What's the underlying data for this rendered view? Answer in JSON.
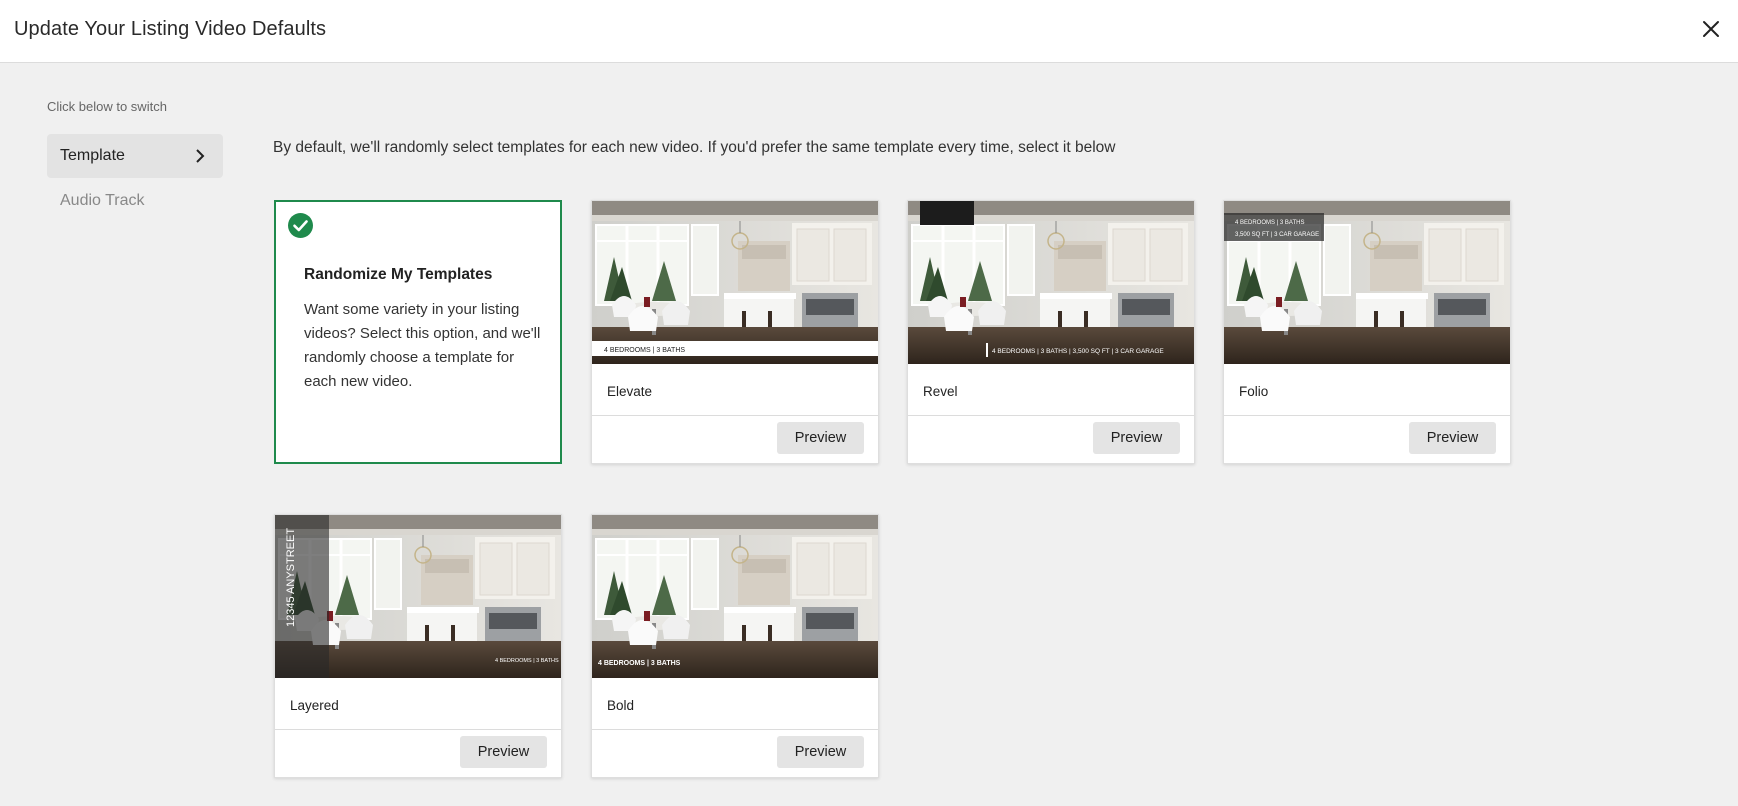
{
  "header": {
    "title": "Update Your Listing Video Defaults"
  },
  "sidebar": {
    "hint": "Click below to switch",
    "items": [
      {
        "label": "Template",
        "active": true
      },
      {
        "label": "Audio Track",
        "active": false
      }
    ]
  },
  "main": {
    "intro": "By default, we'll randomly select templates for each new video. If you'd prefer the same template every time, select it below",
    "random": {
      "title": "Randomize My Templates",
      "description": "Want some variety in your listing videos? Select this option, and we'll randomly choose a template for each new video.",
      "selected": true
    },
    "templates": [
      {
        "name": "Elevate",
        "preview_label": "Preview",
        "overlay": "4 BEDROOMS  |  3 BATHS"
      },
      {
        "name": "Revel",
        "preview_label": "Preview",
        "overlay": "4 BEDROOMS  |  3 BATHS  |  3,500 SQ FT  |  3 CAR GARAGE"
      },
      {
        "name": "Folio",
        "preview_label": "Preview",
        "overlay_line1": "4 BEDROOMS  |  3 BATHS",
        "overlay_line2": "3,500 SQ FT  |  3 CAR GARAGE"
      },
      {
        "name": "Layered",
        "preview_label": "Preview",
        "overlay_vertical": "12345 ANYSTREET",
        "overlay": "4 BEDROOMS  |  3 BATHS"
      },
      {
        "name": "Bold",
        "preview_label": "Preview",
        "overlay": "4 BEDROOMS  |  3 BATHS"
      }
    ]
  },
  "colors": {
    "accent": "#1f8a4c",
    "background": "#f0f0f0"
  }
}
